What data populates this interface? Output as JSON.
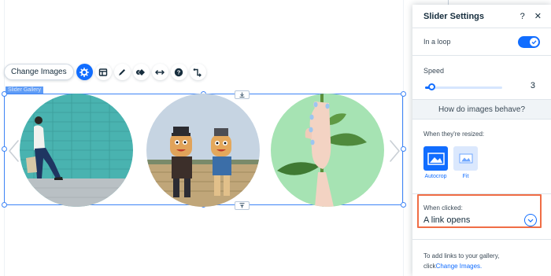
{
  "toolbar": {
    "change_images_label": "Change Images",
    "icons": [
      "settings-icon",
      "layout-icon",
      "design-icon",
      "animation-icon",
      "stretch-icon",
      "help-icon",
      "connect-icon"
    ]
  },
  "element_tag": "Slider Gallery",
  "gallery": {
    "images": [
      "woman-walking-by-tiled-wall",
      "scarecrows-in-field",
      "hand-holding-leaf-stem"
    ]
  },
  "panel": {
    "title": "Slider Settings",
    "help_label": "?",
    "close_label": "✕",
    "loop_label": "In a loop",
    "loop_on": true,
    "speed_label": "Speed",
    "speed_value": "3",
    "speed_fraction": 0.08,
    "section_label": "How do images behave?",
    "resize_label": "When they're resized:",
    "resize_options": [
      {
        "label": "Autocrop",
        "selected": true
      },
      {
        "label": "Fit",
        "selected": false
      }
    ],
    "clicked_label": "When clicked:",
    "clicked_value": "A link opens",
    "footer_text": "To add links to your gallery,",
    "footer_prefix": "click",
    "footer_link": "Change Images."
  },
  "colors": {
    "accent": "#116dff",
    "highlight": "#f06d45",
    "tag": "#5f9cf6"
  }
}
